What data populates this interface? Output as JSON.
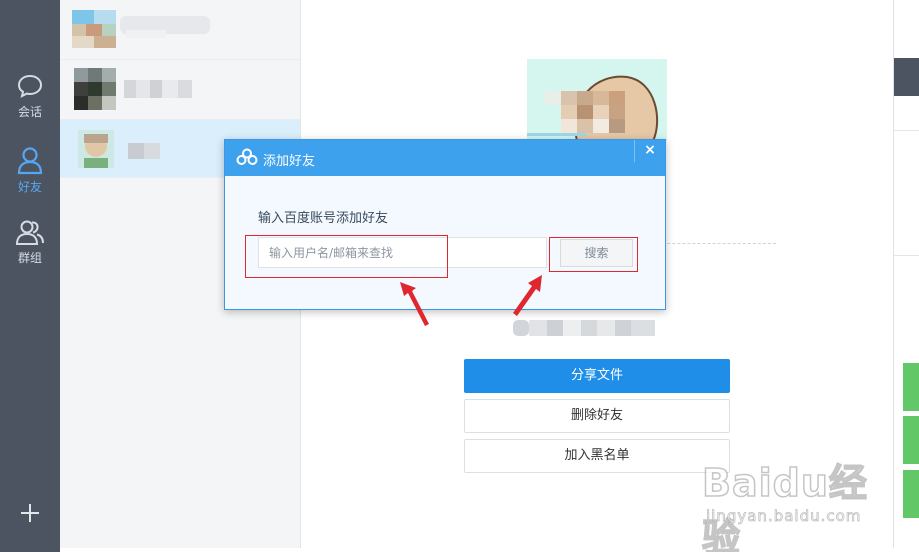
{
  "nav": {
    "items": [
      {
        "label": "会话",
        "icon": "chat-bubble-icon"
      },
      {
        "label": "好友",
        "icon": "person-icon"
      },
      {
        "label": "群组",
        "icon": "group-icon"
      }
    ],
    "add_icon": "plus-icon"
  },
  "main": {
    "buttons": {
      "share": "分享文件",
      "delete": "删除好友",
      "blacklist": "加入黑名单"
    }
  },
  "dialog": {
    "title": "添加好友",
    "close": "×",
    "subtitle": "输入百度账号添加好友",
    "input_placeholder": "输入用户名/邮箱来查找",
    "search_label": "搜索"
  },
  "watermark": {
    "logo": "Baidu经验",
    "url": "jingyan.baidu.com"
  },
  "colors": {
    "nav_bg": "#4c5462",
    "accent": "#1e8ee9",
    "dialog_header": "#3ea1ee",
    "annotation": "#e0272f"
  }
}
